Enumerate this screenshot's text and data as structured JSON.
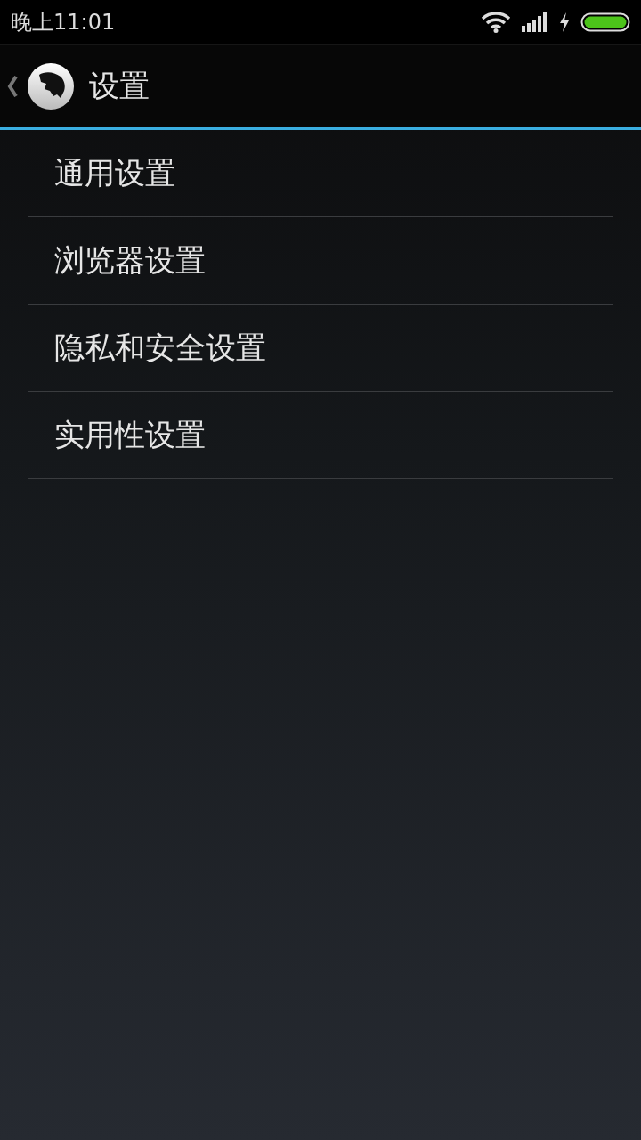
{
  "status_bar": {
    "time": "晚上11:01"
  },
  "header": {
    "title": "设置"
  },
  "menu": [
    {
      "label": "通用设置"
    },
    {
      "label": "浏览器设置"
    },
    {
      "label": "隐私和安全设置"
    },
    {
      "label": "实用性设置"
    }
  ]
}
